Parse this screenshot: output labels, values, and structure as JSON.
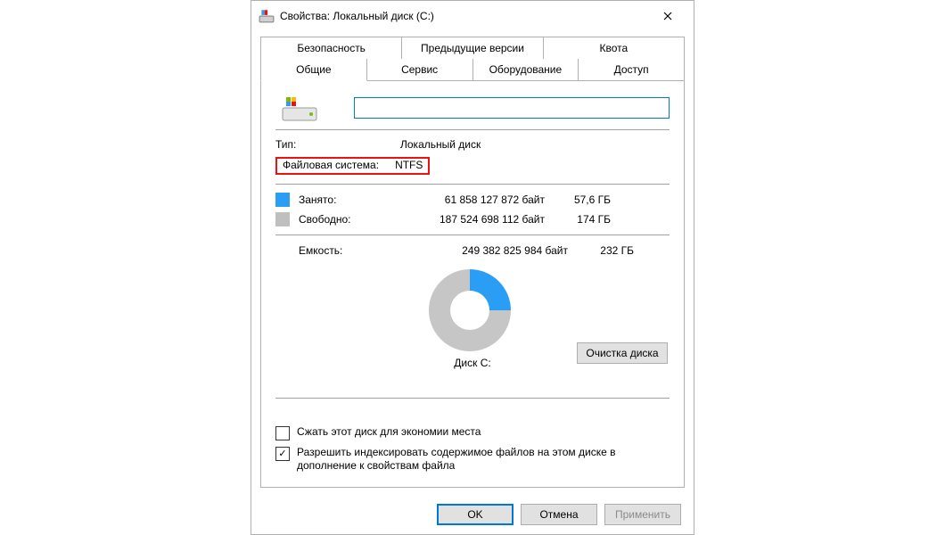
{
  "title": "Свойства: Локальный диск (C:)",
  "tabs": {
    "row1": [
      "Безопасность",
      "Предыдущие версии",
      "Квота"
    ],
    "row2": [
      "Общие",
      "Сервис",
      "Оборудование",
      "Доступ"
    ]
  },
  "volume_label": "",
  "type": {
    "label": "Тип:",
    "value": "Локальный диск"
  },
  "filesystem": {
    "label": "Файловая система:",
    "value": "NTFS"
  },
  "usage": {
    "used": {
      "label": "Занято:",
      "bytes": "61 858 127 872 байт",
      "human": "57,6 ГБ"
    },
    "free": {
      "label": "Свободно:",
      "bytes": "187 524 698 112 байт",
      "human": "174 ГБ"
    }
  },
  "capacity": {
    "label": "Емкость:",
    "bytes": "249 382 825 984 байт",
    "human": "232 ГБ"
  },
  "disk_caption": "Диск C:",
  "cleanup_button": "Очистка диска",
  "options": {
    "compress": "Сжать этот диск для экономии места",
    "index": "Разрешить индексировать содержимое файлов на этом диске в дополнение к свойствам файла"
  },
  "buttons": {
    "ok": "OK",
    "cancel": "Отмена",
    "apply": "Применить"
  },
  "colors": {
    "used": "#2a9df4",
    "free": "#bfbfbf",
    "accent": "#0078d4",
    "highlight": "#e11"
  },
  "chart_data": {
    "type": "pie",
    "title": "Диск C:",
    "series": [
      {
        "name": "Занято",
        "value": 61858127872,
        "human": "57,6 ГБ",
        "color": "#2a9df4"
      },
      {
        "name": "Свободно",
        "value": 187524698112,
        "human": "174 ГБ",
        "color": "#bfbfbf"
      }
    ],
    "total": {
      "name": "Емкость",
      "value": 249382825984,
      "human": "232 ГБ"
    }
  }
}
